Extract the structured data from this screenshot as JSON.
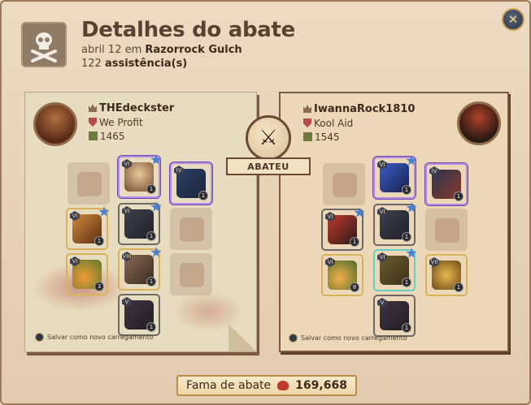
{
  "header": {
    "title": "Detalhes do abate",
    "date": "abril 12",
    "in_word": "em",
    "location": "Razorrock Gulch",
    "assists_count": "122",
    "assists_label": "assistência(s)"
  },
  "center": {
    "ribbon": "ABATEU"
  },
  "killer": {
    "name": "THEdeckster",
    "guild": "We Profit",
    "ip": "1465",
    "save_label": "Salvar como novo carregamento"
  },
  "victim": {
    "name": "IwannaRock1810",
    "guild": "Kool Aid",
    "ip": "1545",
    "save_label": "Salvar como novo carregamento"
  },
  "footer": {
    "label": "Fama de abate",
    "value": "169,668"
  },
  "killer_items": [
    {
      "slot": "bag",
      "empty": true
    },
    {
      "slot": "head",
      "tier": "VI",
      "qty": "1",
      "star": true
    },
    {
      "slot": "cape",
      "tier": "IV",
      "qty": "1"
    },
    {
      "slot": "mainhand",
      "tier": "VI",
      "qty": "1",
      "star": true
    },
    {
      "slot": "armor",
      "tier": "VI",
      "qty": "1",
      "star": true
    },
    {
      "slot": "offhand",
      "empty": true
    },
    {
      "slot": "potion",
      "tier": "VI",
      "qty": "3"
    },
    {
      "slot": "shoes",
      "tier": "VIII",
      "qty": "1",
      "star": true
    },
    {
      "slot": "food",
      "empty": true
    },
    {
      "slot": "mount",
      "tier": "V",
      "qty": "1"
    }
  ],
  "victim_items": [
    {
      "slot": "bag",
      "empty": true
    },
    {
      "slot": "head",
      "tier": "VI",
      "qty": "1",
      "star": true
    },
    {
      "slot": "cape",
      "tier": "IV",
      "qty": "1"
    },
    {
      "slot": "mainhand",
      "tier": "VI",
      "qty": "1",
      "star": true
    },
    {
      "slot": "armor",
      "tier": "VI",
      "qty": "1",
      "star": true
    },
    {
      "slot": "offhand",
      "empty": true
    },
    {
      "slot": "potion",
      "tier": "VI",
      "qty": "8"
    },
    {
      "slot": "shoes",
      "tier": "VI",
      "qty": "1",
      "star": true
    },
    {
      "slot": "food",
      "tier": "VII",
      "qty": "1"
    },
    {
      "slot": "mount",
      "tier": "V",
      "qty": "1"
    }
  ]
}
